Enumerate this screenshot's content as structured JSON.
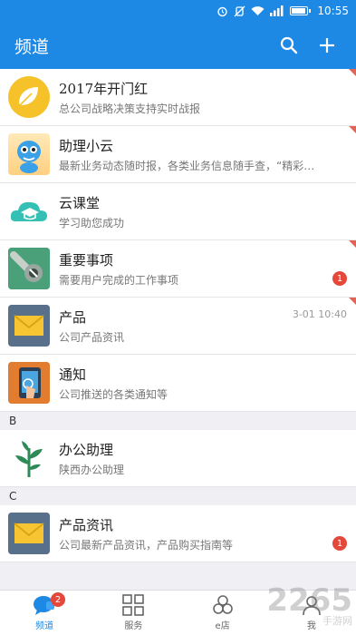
{
  "status_bar": {
    "time": "10:55"
  },
  "app_bar": {
    "title": "频道"
  },
  "channels_top": [
    {
      "name": "2017年开门红",
      "desc": "总公司战略决策支持实时战报",
      "icon": "leaf-icon"
    },
    {
      "name": "助理小云",
      "desc": "最新业务动态随时报，各类业务信息随手查，“精彩…",
      "icon": "mascot-icon"
    },
    {
      "name": "云课堂",
      "desc": "学习助您成功",
      "icon": "cloud-graduation-icon"
    },
    {
      "name": "重要事项",
      "desc": "需要用户完成的工作事项",
      "icon": "wrench-icon",
      "badge": "1"
    },
    {
      "name": "产品",
      "desc": "公司产品资讯",
      "icon": "envelope-icon",
      "time": "3-01 10:40"
    },
    {
      "name": "通知",
      "desc": "公司推送的各类通知等",
      "icon": "tablet-touch-icon"
    }
  ],
  "section_b": {
    "letter": "B"
  },
  "channels_b": [
    {
      "name": "办公助理",
      "desc": "陕西办公助理",
      "icon": "plant-icon"
    }
  ],
  "section_c": {
    "letter": "C"
  },
  "channels_c": [
    {
      "name": "产品资讯",
      "desc": "公司最新产品资讯，产品购买指南等",
      "icon": "envelope-icon",
      "badge": "1"
    }
  ],
  "tabs": [
    {
      "label": "频道",
      "icon": "chat-bubble-icon",
      "badge": "2"
    },
    {
      "label": "服务",
      "icon": "grid-icon"
    },
    {
      "label": "e店",
      "icon": "circles-icon"
    },
    {
      "label": "我",
      "icon": "person-icon"
    }
  ],
  "watermark": {
    "text": "2265",
    "sub": "手游网"
  },
  "colors": {
    "primary": "#1e88e5",
    "badge": "#e4483b",
    "corner": "#e26457"
  }
}
